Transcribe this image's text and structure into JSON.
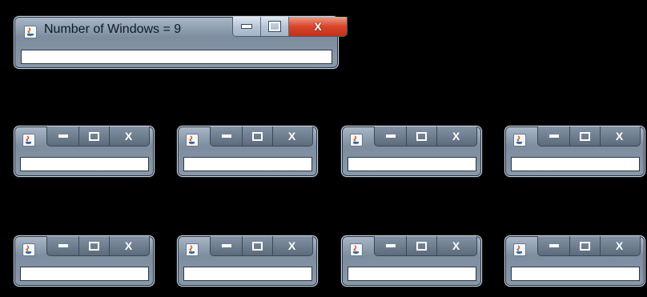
{
  "main_window": {
    "title": "Number of Windows = 9",
    "field_value": "",
    "buttons": {
      "minimize": "minimize-icon",
      "maximize": "maximize-icon",
      "close": "close-icon"
    }
  },
  "small_windows": {
    "count": 8,
    "field_value": ""
  },
  "colors": {
    "desktop": "#000000",
    "close_button": "#d8462b",
    "frame": "#8a99aa"
  }
}
